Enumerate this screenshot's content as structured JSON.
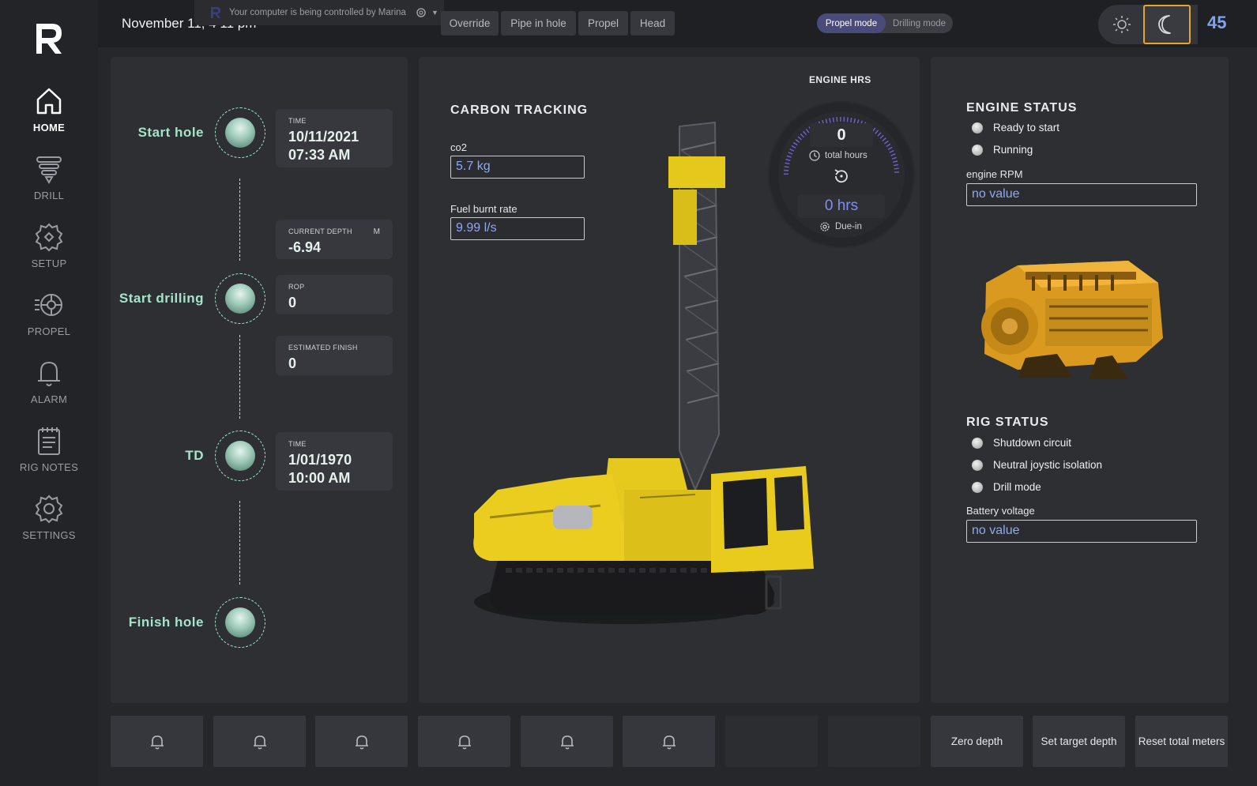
{
  "sidebar": {
    "items": [
      {
        "label": "HOME",
        "icon": "home-icon"
      },
      {
        "label": "DRILL",
        "icon": "drill-icon"
      },
      {
        "label": "SETUP",
        "icon": "setup-gear-icon"
      },
      {
        "label": "PROPEL",
        "icon": "propel-icon"
      },
      {
        "label": "ALARM",
        "icon": "bell-icon"
      },
      {
        "label": "RIG NOTES",
        "icon": "notes-icon"
      },
      {
        "label": "SETTINGS",
        "icon": "settings-gear-icon"
      }
    ]
  },
  "header": {
    "datetime": "November 11, 4 11 pm",
    "control_banner": "Your computer is being controlled by Marina",
    "buttons": [
      "Override",
      "Pipe in hole",
      "Propel",
      "Head"
    ],
    "modes": [
      "Propel mode",
      "Drilling mode"
    ],
    "active_mode": "Propel mode",
    "counter": "45"
  },
  "timeline": {
    "stages": [
      {
        "label": "Start hole"
      },
      {
        "label": "Start drilling"
      },
      {
        "label": "TD"
      },
      {
        "label": "Finish hole"
      }
    ],
    "cards": {
      "start_time": {
        "label": "TIME",
        "date": "10/11/2021",
        "time": "07:33 AM"
      },
      "current_depth": {
        "label": "CURRENT DEPTH",
        "unit": "M",
        "value": "-6.94"
      },
      "rop": {
        "label": "ROP",
        "value": "0"
      },
      "estimated_finish": {
        "label": "ESTIMATED FINISH",
        "value": "0"
      },
      "td_time": {
        "label": "TIME",
        "date": "1/01/1970",
        "time": "10:00 AM"
      }
    }
  },
  "carbon": {
    "title": "CARBON TRACKING",
    "co2_label": "co2",
    "co2_value": "5.7 kg",
    "fuel_label": "Fuel burnt rate",
    "fuel_value": "9.99 l/s"
  },
  "engine_hrs": {
    "title": "ENGINE HRS",
    "total": "0",
    "total_label": "total hours",
    "due_value": "0 hrs",
    "due_label": "Due-in"
  },
  "engine_status": {
    "title": "ENGINE STATUS",
    "indicators": [
      "Ready to start",
      "Running"
    ],
    "rpm_label": "engine RPM",
    "rpm_value": "no value"
  },
  "rig_status": {
    "title": "RIG STATUS",
    "indicators": [
      "Shutdown circuit",
      "Neutral joystic isolation",
      "Drill mode"
    ],
    "battery_label": "Battery voltage",
    "battery_value": "no value"
  },
  "bottom": {
    "actions": [
      "Zero depth",
      "Set target depth",
      "Reset total meters"
    ]
  },
  "colors": {
    "accent_green": "#a6e4c9",
    "accent_blue": "#8fa9ef",
    "highlight": "#e2a629"
  }
}
